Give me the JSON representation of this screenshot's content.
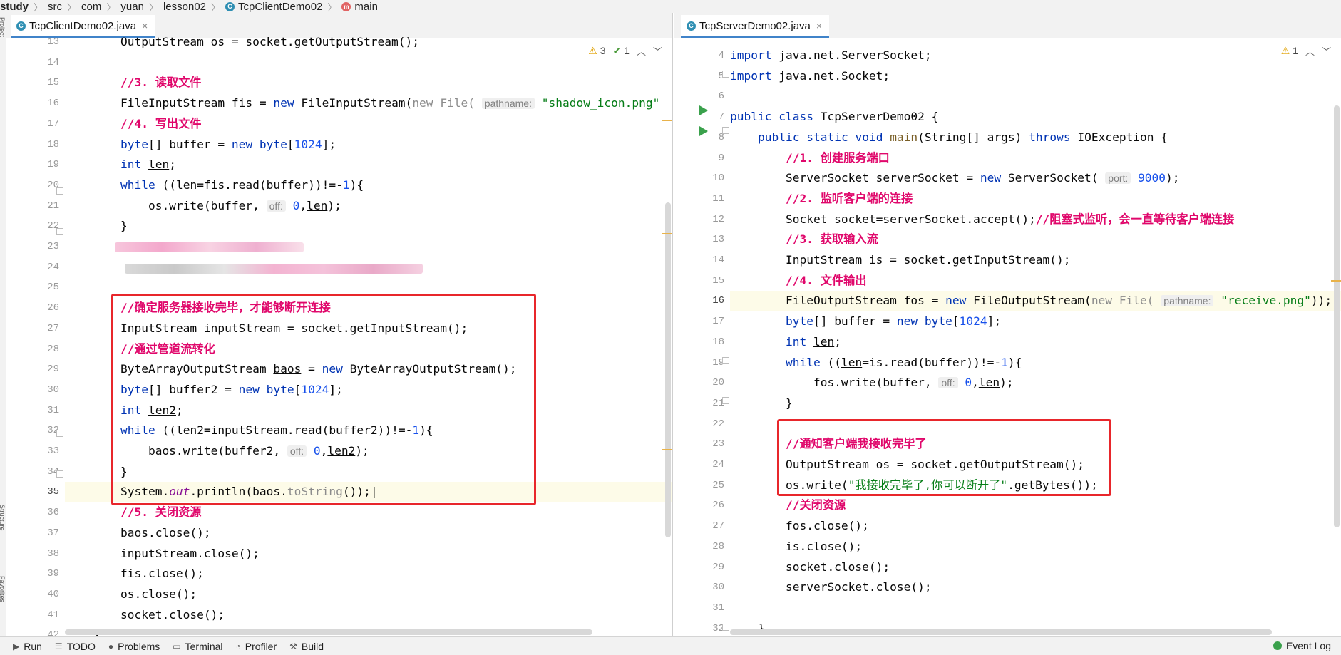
{
  "breadcrumb": {
    "items": [
      "study",
      "src",
      "com",
      "yuan",
      "lesson02",
      "TcpClientDemo02",
      "main"
    ]
  },
  "left_strip": {
    "labels": [
      "Project",
      "Structure",
      "Favorites"
    ]
  },
  "left_editor": {
    "tab": {
      "icon": "class-icon",
      "label": "TcpClientDemo02.java",
      "close": "×"
    },
    "inspections": {
      "warnings": "3",
      "weak_warnings": "1"
    },
    "line_numbers": [
      "13",
      "14",
      "15",
      "16",
      "17",
      "18",
      "19",
      "20",
      "21",
      "22",
      "23",
      "24",
      "25",
      "26",
      "27",
      "28",
      "29",
      "30",
      "31",
      "32",
      "33",
      "34",
      "35",
      "36",
      "37",
      "38",
      "39",
      "40",
      "41",
      "42"
    ],
    "current_line": "35"
  },
  "right_editor": {
    "tab": {
      "icon": "class-icon",
      "label": "TcpServerDemo02.java",
      "close": "×"
    },
    "inspections": {
      "warnings": "1"
    },
    "line_numbers": [
      "4",
      "5",
      "6",
      "7",
      "8",
      "9",
      "10",
      "11",
      "12",
      "13",
      "14",
      "15",
      "16",
      "17",
      "18",
      "19",
      "20",
      "21",
      "22",
      "23",
      "24",
      "25",
      "26",
      "27",
      "28",
      "29",
      "30",
      "31",
      "32"
    ],
    "current_line": "16"
  },
  "bottom_bar": {
    "run": "Run",
    "todo": "TODO",
    "problems": "Problems",
    "terminal": "Terminal",
    "profiler": "Profiler",
    "build": "Build",
    "event_log": "Event Log"
  },
  "colors": {
    "highlight_box": "#e8262b",
    "comment": "#e0076b",
    "keyword": "#0033b3",
    "string": "#067d17",
    "number": "#1750eb",
    "run_marker": "#3aa14c"
  }
}
